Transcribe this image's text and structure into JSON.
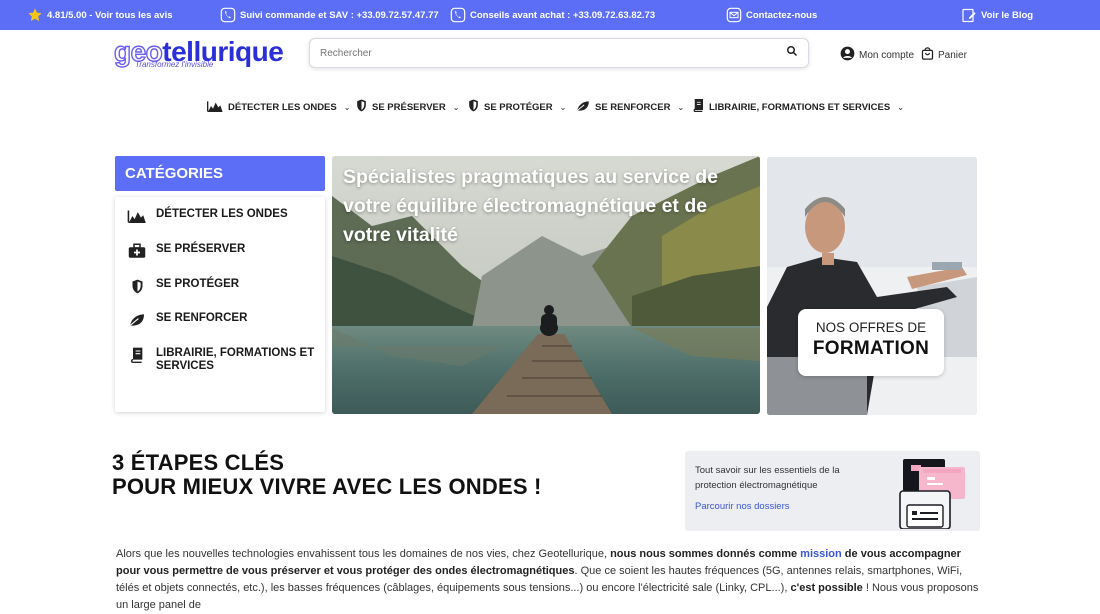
{
  "topbar": {
    "rating": "4.81/5.00 - Voir tous les avis",
    "order_support": "Suivi commande et SAV : +33.09.72.57.47.77",
    "advice": "Conseils avant achat : +33.09.72.63.82.73",
    "contact": "Contactez-nous",
    "blog": "Voir le Blog"
  },
  "header": {
    "logo_part1": "geo",
    "logo_part2": "tellurique",
    "logo_tagline": "Transformez l'invisible",
    "search_placeholder": "Rechercher",
    "account": "Mon compte",
    "cart": "Panier"
  },
  "nav": [
    {
      "label": "DÉTECTER LES ONDES",
      "icon": "waves-chart-icon"
    },
    {
      "label": "SE PRÉSERVER",
      "icon": "shield-icon"
    },
    {
      "label": "SE PROTÉGER",
      "icon": "shield-icon"
    },
    {
      "label": "SE RENFORCER",
      "icon": "leaf-icon"
    },
    {
      "label": "LIBRAIRIE, FORMATIONS ET SERVICES",
      "icon": "book-icon"
    }
  ],
  "categories": {
    "title": "CATÉGORIES",
    "items": [
      {
        "label": "DÉTECTER LES ONDES",
        "icon": "waves-chart-icon"
      },
      {
        "label": "SE PRÉSERVER",
        "icon": "medical-kit-icon"
      },
      {
        "label": "SE PROTÉGER",
        "icon": "shield-icon"
      },
      {
        "label": "SE RENFORCER",
        "icon": "leaf-icon"
      },
      {
        "label": "LIBRAIRIE, FORMATIONS ET",
        "label2": "SERVICES",
        "icon": "book-icon"
      }
    ]
  },
  "hero": {
    "title": "Spécialistes pragmatiques au service de votre équilibre électromagnétique et de votre vitalité"
  },
  "promo": {
    "line1": "NOS OFFRES DE",
    "line2": "FORMATION"
  },
  "steps": {
    "title_line1": "3 ÉTAPES CLÉS",
    "title_line2": "POUR MIEUX VIVRE AVEC LES ONDES !"
  },
  "dossier": {
    "text": "Tout savoir sur les essentiels de la protection électromagnétique",
    "link": "Parcourir nos dossiers"
  },
  "intro": {
    "p1": "Alors que les nouvelles technologies envahissent tous les domaines de nos vies, chez Geotellurique, ",
    "p2": "nous nous sommes donnés comme ",
    "p3": "mission",
    "p4": " de vous accompagner pour vous permettre de vous préserver et vous protéger des ondes électromagnétiques",
    "p5": ". Que ce soient les hautes fréquences (5G, antennes relais, smartphones, WiFi, télés et objets connectés, etc.), les basses fréquences (câblages, équipements sous tensions...) ou encore l'électricité sale (Linky, CPL...), ",
    "p6": "c'est possible",
    "p7": " ! Nous vous proposons un large panel de"
  },
  "colors": {
    "accent": "#5b6ef5",
    "link": "#3a56d6",
    "star": "#f5c518"
  }
}
